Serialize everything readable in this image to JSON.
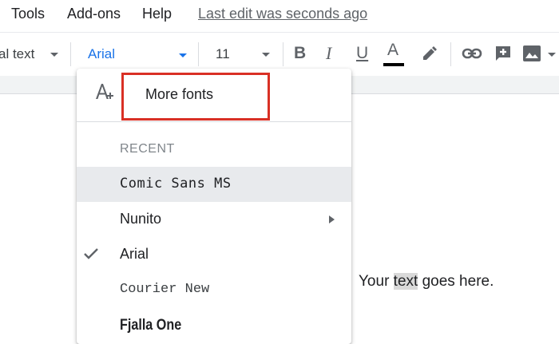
{
  "menubar": {
    "items": [
      "Tools",
      "Add-ons",
      "Help"
    ],
    "last_edit": "Last edit was seconds ago"
  },
  "toolbar": {
    "style_label": "al text",
    "font_label": "Arial",
    "size_label": "11",
    "bold": "B",
    "italic": "I",
    "underline": "U",
    "text_color": "A",
    "accent_color": "#1a73e8"
  },
  "dropdown": {
    "more_fonts": "More fonts",
    "recent_header": "RECENT",
    "fonts": [
      {
        "label": "Comic Sans MS"
      },
      {
        "label": "Nunito"
      },
      {
        "label": "Arial"
      },
      {
        "label": "Courier New"
      },
      {
        "label": "Fjalla One"
      }
    ],
    "highlight_color": "#d93025"
  },
  "document": {
    "text_before": "Your ",
    "text_selected": "text",
    "text_after": " goes here."
  }
}
